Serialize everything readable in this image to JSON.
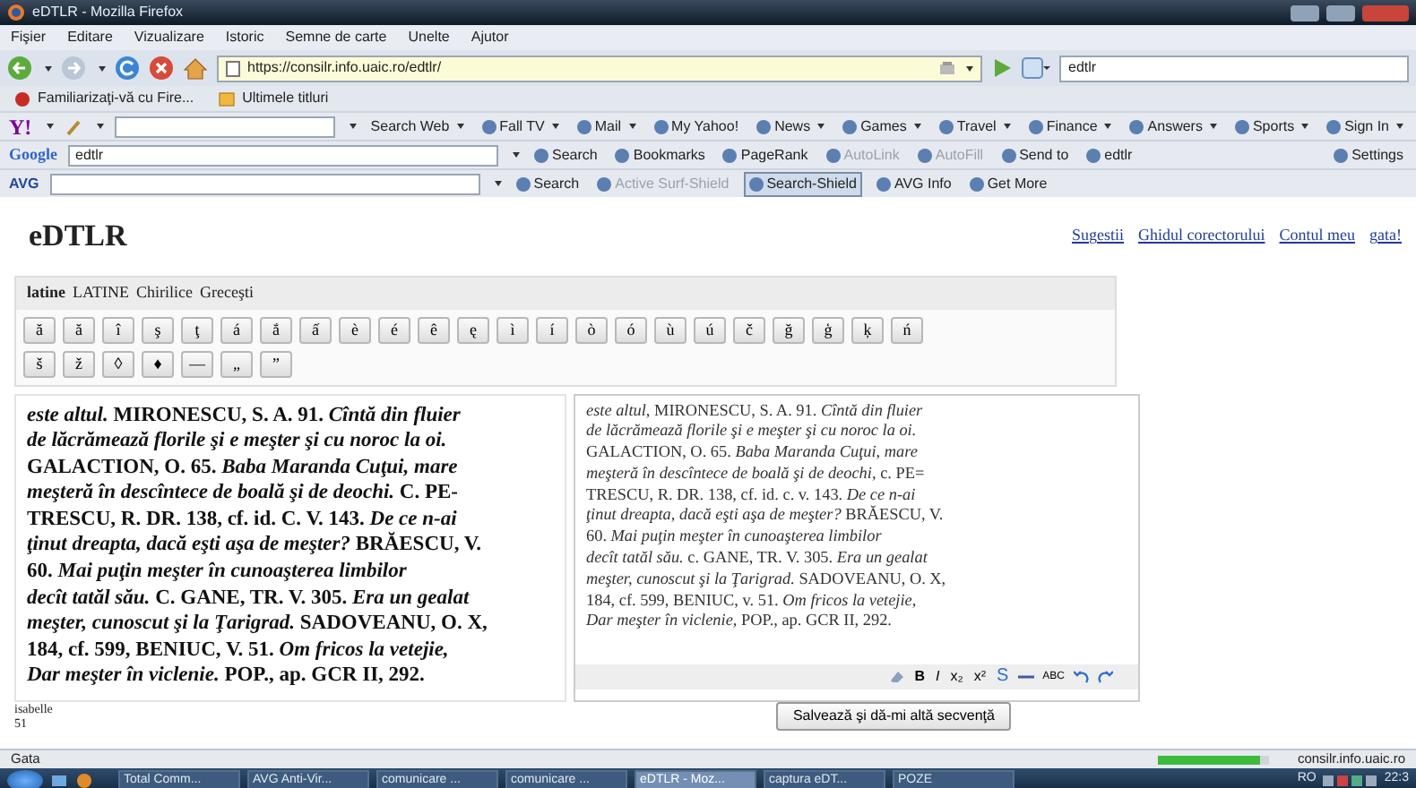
{
  "window": {
    "title": "eDTLR - Mozilla Firefox"
  },
  "menu": [
    "Fişier",
    "Editare",
    "Vizualizare",
    "Istoric",
    "Semne de carte",
    "Unelte",
    "Ajutor"
  ],
  "address_bar": {
    "url": "https://consilr.info.uaic.ro/edtlr/"
  },
  "search_box": {
    "value": "edtlr"
  },
  "bookmarks": [
    "Familiarizaţi-vă cu Fire...",
    "Ultimele titluri"
  ],
  "yahoo_toolbar": {
    "logo": "Y!",
    "items": [
      {
        "label": "Search Web",
        "dropdown": true
      },
      {
        "label": "Fall TV",
        "dropdown": true
      },
      {
        "label": "Mail",
        "dropdown": true
      },
      {
        "label": "My Yahoo!",
        "dropdown": false
      },
      {
        "label": "News",
        "dropdown": true
      },
      {
        "label": "Games",
        "dropdown": true
      },
      {
        "label": "Travel",
        "dropdown": true
      },
      {
        "label": "Finance",
        "dropdown": true
      },
      {
        "label": "Answers",
        "dropdown": true
      },
      {
        "label": "Sports",
        "dropdown": true
      },
      {
        "label": "Sign In",
        "dropdown": true
      }
    ]
  },
  "google_toolbar": {
    "logo": "Google",
    "query": "edtlr",
    "items": [
      {
        "label": "Search",
        "disabled": false,
        "selected": false
      },
      {
        "label": "Bookmarks",
        "disabled": false,
        "selected": false
      },
      {
        "label": "PageRank",
        "disabled": false,
        "selected": false
      },
      {
        "label": "AutoLink",
        "disabled": true,
        "selected": false
      },
      {
        "label": "AutoFill",
        "disabled": true,
        "selected": false
      },
      {
        "label": "Send to",
        "disabled": false,
        "selected": false
      },
      {
        "label": "edtlr",
        "disabled": false,
        "selected": false
      }
    ],
    "settings": "Settings"
  },
  "avg_toolbar": {
    "logo": "AVG",
    "items": [
      {
        "label": "Search",
        "disabled": false,
        "selected": false
      },
      {
        "label": "Active Surf-Shield",
        "disabled": true,
        "selected": false
      },
      {
        "label": "Search-Shield",
        "disabled": false,
        "selected": true
      },
      {
        "label": "AVG Info",
        "disabled": false,
        "selected": false
      },
      {
        "label": "Get More",
        "disabled": false,
        "selected": false
      }
    ]
  },
  "page": {
    "title": "eDTLR",
    "links": [
      "Sugestii",
      "Ghidul corectorului",
      "Contul meu",
      "gata!"
    ]
  },
  "charset_tabs": [
    {
      "label": "latine",
      "selected": true
    },
    {
      "label": "LATINE",
      "selected": false
    },
    {
      "label": "Chirilice",
      "selected": false
    },
    {
      "label": "Greceşti",
      "selected": false
    }
  ],
  "char_buttons": [
    [
      "ă",
      "ă",
      "î",
      "ş",
      "ţ",
      "á",
      "ắ",
      "ấ",
      "è",
      "é",
      "ê",
      "ę",
      "ì",
      "í",
      "ò",
      "ó",
      "ù",
      "ú",
      "č",
      "ğ",
      "ģ",
      "ķ",
      "ń"
    ],
    [
      "š",
      "ž",
      "◊",
      "♦",
      "—",
      "„",
      "”"
    ]
  ],
  "scan_text": {
    "lines": [
      "*este altul.* MIRONESCU, S. A. 91. *Cîntă din fluier*",
      "*de lăcrămează florile şi e meşter şi cu noroc la oi.*",
      "GALACTION, O. 65. *Baba Maranda Cuţui, mare*",
      "*meşteră în descîntece de boală şi de deochi.* C. PE-",
      "TRESCU, R. DR. 138, cf. id. C. V. 143. *De ce n-ai*",
      "*ţinut dreapta, dacă eşti aşa de meşter?* BRĂESCU, V.",
      "60. *Mai puţin meşter în cunoaşterea limbilor*",
      "*decît tatăl său.* C. GANE, TR. V. 305. *Era un gealat*",
      "*meşter, cunoscut şi la Ţarigrad.* SADOVEANU, O. X,",
      "184, cf. 599, BENIUC, V. 51. *Om fricos la vetejie,*",
      "*Dar meşter în viclenie.* POP., ap. GCR II, 292."
    ]
  },
  "editor": {
    "lines": [
      "*este altul,* MIRONESCU, S. A. 91. *Cîntă din fluier*",
      "*de lăcrămează florile şi e meşter şi cu noroc la oi.*",
      "GALACTION, O. 65. *Baba Maranda Cuţui, mare*",
      "*meşteră în descîntece de boală şi de deochi,* c. PE=",
      "TRESCU, R. DR. 138, cf. id. c. v. 143. *De ce n-ai*",
      "*ţinut dreapta, dacă eşti aşa de meşter?* BRĂESCU, V.",
      "60. *Mai puţin meşter în cunoaşterea limbilor*",
      "*decît tatăl său.* c. GANE, TR. V. 305. *Era un gealat*",
      "*meşter, cunoscut şi la Ţarigrad.* SADOVEANU, O. X,",
      "184, cf. 599, BENIUC, v. 51. *Om fricos la vetejie,*",
      "*Dar meşter în viclenie,* POP., ap. GCR II, 292."
    ],
    "toolbar": [
      {
        "kind": "eraser"
      },
      {
        "kind": "bold",
        "label": "B"
      },
      {
        "kind": "italic",
        "label": "I"
      },
      {
        "kind": "subscript",
        "label": "x₂"
      },
      {
        "kind": "superscript",
        "label": "x²"
      },
      {
        "kind": "strike",
        "label": "S"
      },
      {
        "kind": "rule"
      },
      {
        "kind": "spell",
        "label": "ABC"
      },
      {
        "kind": "undo"
      },
      {
        "kind": "redo"
      }
    ]
  },
  "user": {
    "name": "isabelle",
    "count": "51"
  },
  "save_button": "Salvează şi dă-mi altă secvenţă",
  "status_bar": {
    "text": "Gata",
    "progress": {
      "level": 0.92
    },
    "host": "consilr.info.uaic.ro"
  },
  "taskbar": {
    "items": [
      {
        "label": "Total Comm...",
        "selected": false
      },
      {
        "label": "AVG Anti-Vir...",
        "selected": false
      },
      {
        "label": "comunicare ...",
        "selected": false
      },
      {
        "label": "comunicare ...",
        "selected": false
      },
      {
        "label": "eDTLR - Moz...",
        "selected": true
      },
      {
        "label": "captura eDT...",
        "selected": false
      },
      {
        "label": "POZE",
        "selected": false
      }
    ],
    "language": "RO",
    "clock": "22:3"
  }
}
